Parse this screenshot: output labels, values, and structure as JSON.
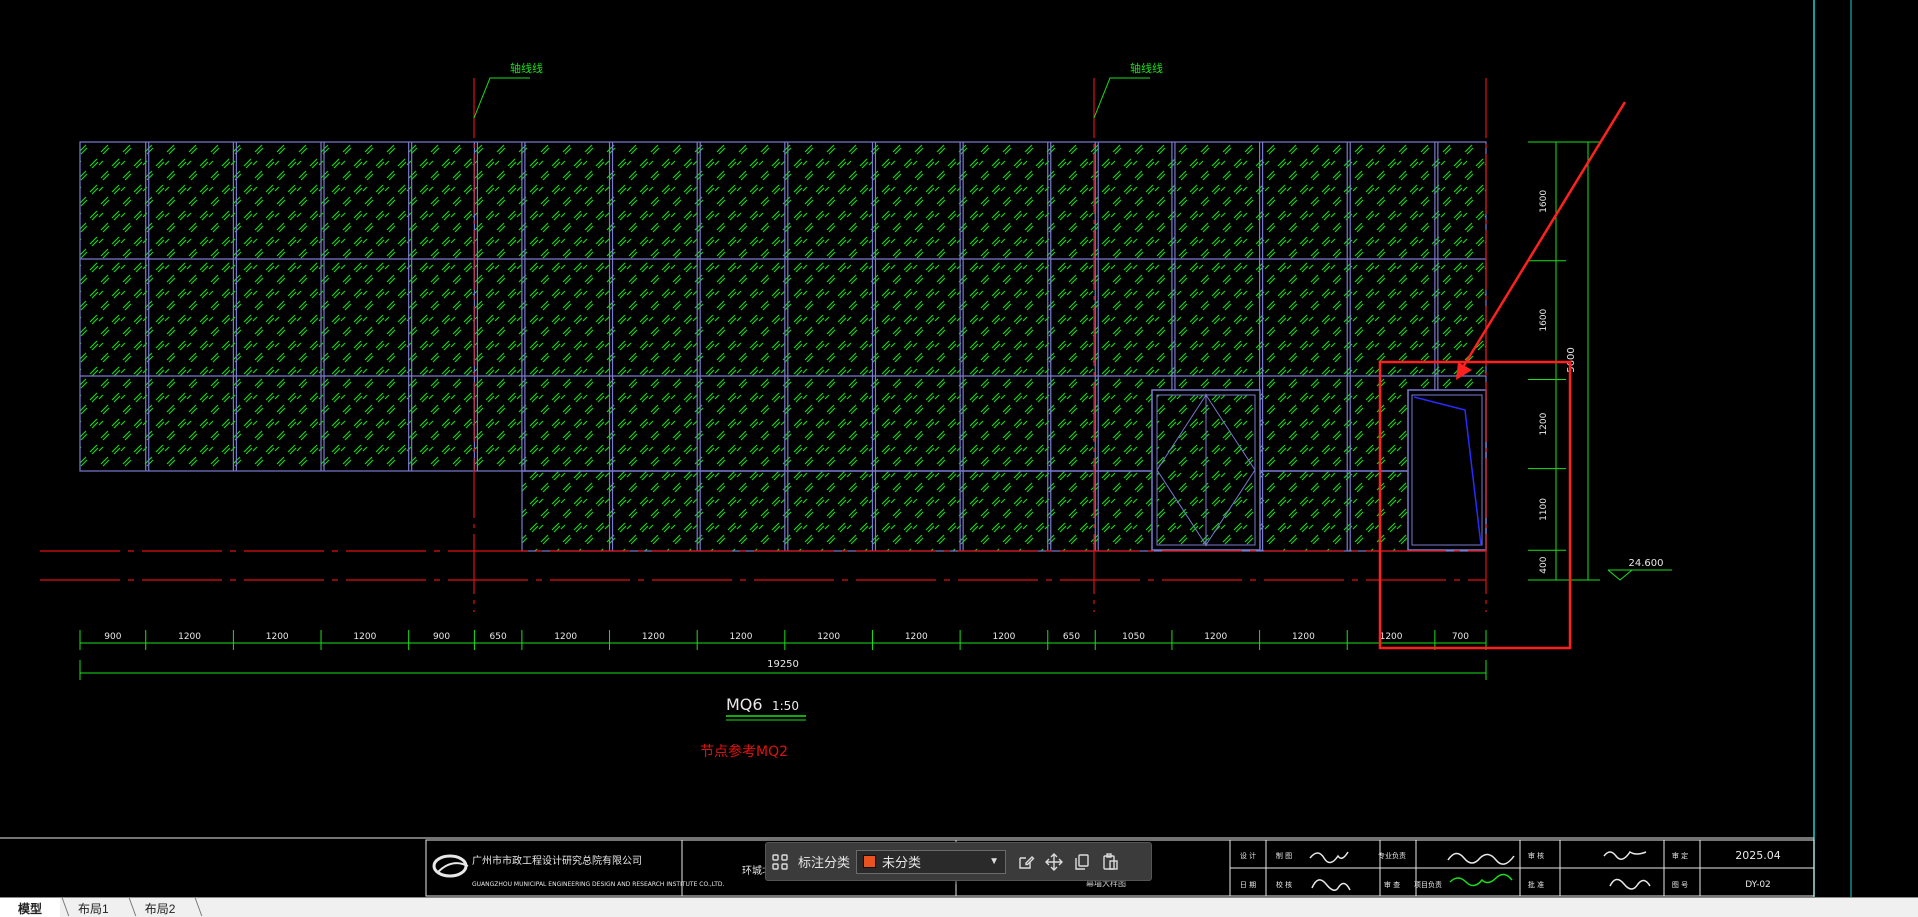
{
  "drawing": {
    "axis_labels": [
      "轴线线",
      "轴线线"
    ],
    "bottom_dims": [
      "900",
      "1200",
      "1200",
      "1200",
      "900",
      "650",
      "1200",
      "1200",
      "1200",
      "1200",
      "1200",
      "1200",
      "650",
      "1050",
      "1200",
      "1200",
      "1200",
      "700"
    ],
    "total_dim": "19250",
    "right_dims": [
      "1600",
      "1600",
      "1200",
      "1100",
      "400"
    ],
    "right_total": "5600",
    "level": "24.600",
    "title_code": "MQ6",
    "title_scale": "1:50",
    "note": "节点参考MQ2",
    "colors": {
      "panel": "#7a7ad0",
      "hatch": "#19d219",
      "dim": "#19e019",
      "red": "#e01010",
      "cyan": "#19d2d2",
      "highlight": "#ff2020"
    }
  },
  "title_block": {
    "company_cn": "广州市市政工程设计研究总院有限公司",
    "company_en": "GUANGZHOU MUNICIPAL ENGINEERING DESIGN AND RESEARCH INSTITUTE CO.,LTD.",
    "project_fragment": "环城北",
    "drawing_fragment": "幕墙大样图",
    "roles": [
      "设 计",
      "制 图",
      "专业负责",
      "审 核",
      "审 定",
      "日 期",
      "校 核",
      "审 查",
      "项目负责",
      "批 准",
      "图 号"
    ],
    "date": "2025.04",
    "drawing_no": "DY-02"
  },
  "annotation_toolbar": {
    "label": "标注分类",
    "selected": "未分类",
    "icons": [
      "grid-icon",
      "edit-icon",
      "move-icon",
      "copy-icon",
      "paste-icon"
    ]
  },
  "layout_tabs": [
    {
      "label": "模型",
      "active": true
    },
    {
      "label": "布局1",
      "active": false
    },
    {
      "label": "布局2",
      "active": false
    }
  ]
}
